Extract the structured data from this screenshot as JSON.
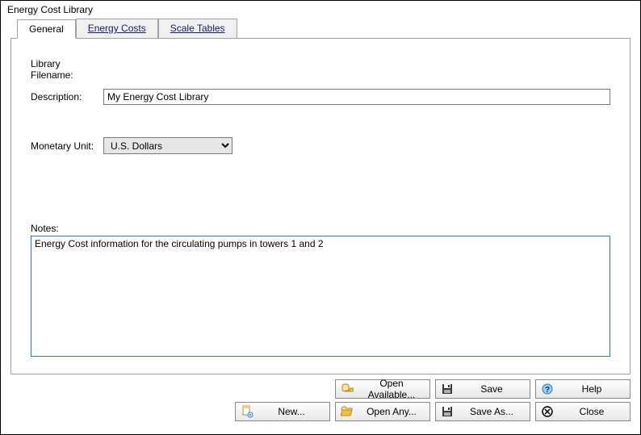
{
  "window": {
    "title": "Energy Cost Library"
  },
  "tabs": {
    "general": "General",
    "energy_costs": "Energy Costs",
    "scale_tables": "Scale Tables"
  },
  "form": {
    "library_filename_label": "Library Filename:",
    "description_label": "Description:",
    "description_value": "My Energy Cost Library",
    "monetary_unit_label": "Monetary Unit:",
    "monetary_unit_value": "U.S. Dollars",
    "notes_label": "Notes:",
    "notes_value": "Energy Cost information for the circulating pumps in towers 1 and 2"
  },
  "buttons": {
    "new": "New...",
    "open_available": "Open Available...",
    "open_any": "Open Any...",
    "save": "Save",
    "save_as": "Save As...",
    "help": "Help",
    "close": "Close"
  }
}
